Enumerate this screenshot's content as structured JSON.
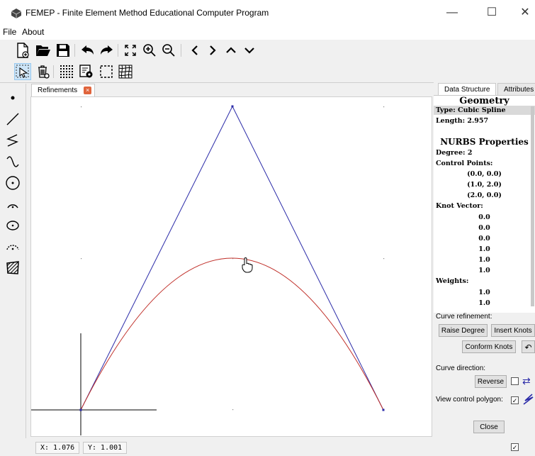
{
  "window": {
    "title": "FEMEP - Finite Element Method Educational Computer Program",
    "minimize": "—",
    "maximize": "☐",
    "close": "✕"
  },
  "menu": [
    "File",
    "About"
  ],
  "tabs": {
    "main": "Refinements",
    "close_glyph": "×"
  },
  "status": {
    "x": "X: 1.076",
    "y": "Y: 1.001"
  },
  "right_tabs": [
    "Data Structure",
    "Attributes"
  ],
  "geometry": {
    "header": "Geometry",
    "type": "Type: Cubic Spline",
    "length": "Length: 2.957"
  },
  "nurbs": {
    "header": "NURBS Properties",
    "degree": "Degree: 2",
    "control_points_label": "Control Points:",
    "control_points": [
      "(0.0, 0.0)",
      "(1.0, 2.0)",
      "(2.0, 0.0)"
    ],
    "knot_vector_label": "Knot Vector:",
    "knot_vector": [
      "0.0",
      "0.0",
      "0.0",
      "1.0",
      "1.0",
      "1.0"
    ],
    "weights_label": "Weights:",
    "weights": [
      "1.0",
      "1.0"
    ]
  },
  "refinement": {
    "label": "Curve refinement:",
    "raise_degree": "Raise Degree",
    "insert_knots": "Insert Knots",
    "conform_knots": "Conform Knots",
    "undo_glyph": "↶"
  },
  "direction": {
    "label": "Curve direction:",
    "reverse": "Reverse",
    "swap_glyph": "⇄"
  },
  "polygon": {
    "label": "View control polygon:",
    "checked": true
  },
  "close_button": "Close",
  "colors": {
    "control_polygon": "#2b2ba8",
    "curve": "#c0302a",
    "axes": "#000000"
  }
}
